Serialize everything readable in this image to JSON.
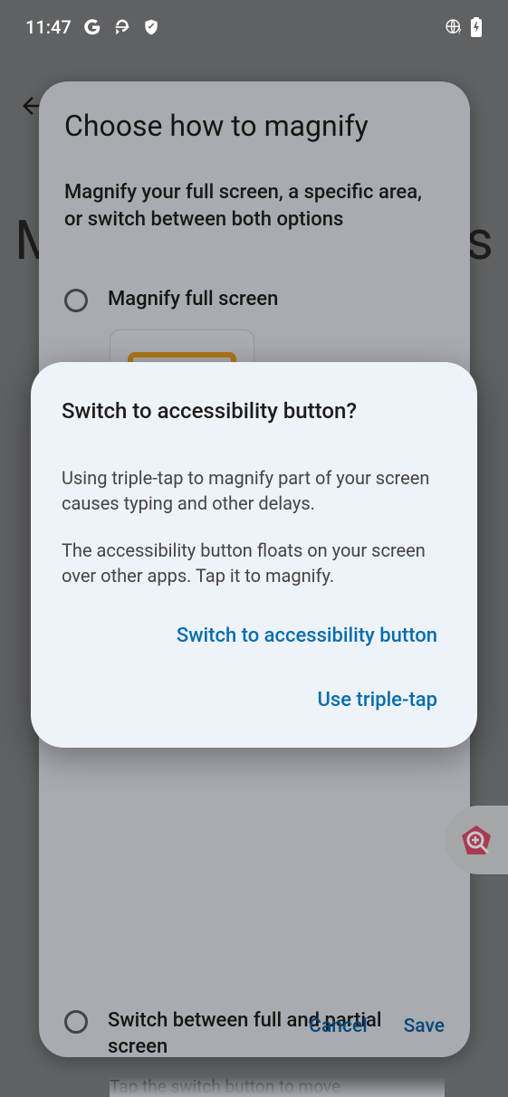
{
  "status": {
    "time": "11:47"
  },
  "bg": {
    "left_letter": "M",
    "right_letter": "s"
  },
  "dialog1": {
    "title": "Choose how to magnify",
    "subtitle": "Magnify your full screen, a specific area, or switch between both options",
    "option1": "Magnify full screen",
    "option2": "Switch between full and partial screen",
    "option2_desc": "Tap the switch button to move",
    "cancel": "Cancel",
    "save": "Save"
  },
  "alert": {
    "title": "Switch to accessibility button?",
    "body1": "Using triple-tap to magnify part of your screen causes typing and other delays.",
    "body2": "The accessibility button floats on your screen over other apps. Tap it to magnify.",
    "action_primary": "Switch to accessibility button",
    "action_secondary": "Use triple-tap"
  }
}
